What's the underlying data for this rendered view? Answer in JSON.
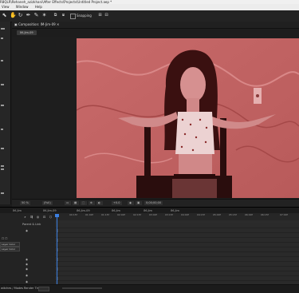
{
  "app": {
    "title_path": "R8QLR\\Rehaneh_azizkhani\\After Effects\\Projects\\Untitled Project.aep *"
  },
  "menu": {
    "items": [
      "View",
      "Window",
      "Help"
    ]
  },
  "toolbar": {
    "tools": [
      "selection-tool-icon",
      "hand-tool-icon",
      "rotate-tool-icon",
      "pen-tool-icon",
      "brush-tool-icon",
      "puppet-tool-icon"
    ],
    "snapping_label": "Snapping"
  },
  "composition": {
    "panel_tab": "Composition: IM-Jim-09",
    "sub_tab": "IM-Jim-09"
  },
  "viewer_bar": {
    "zoom": "50 %",
    "resolution": "(Full)",
    "timecode": "0;00;00;00",
    "exposure": "+0.0"
  },
  "timeline": {
    "tabs": [
      "IM-Jim",
      "IM-Jim-09",
      "IM-Jim-09",
      "IM-Jim",
      "IM-Jim",
      "IM-Jim"
    ],
    "parent_link_header": "Parent & Link",
    "dropdowns": [
      "Layer Color",
      "Layer Color"
    ],
    "ruler_ticks": [
      "0f",
      "00:15f",
      "01:00f",
      "01:15f",
      "02:00f",
      "02:15f",
      "03:00f",
      "03:15f",
      "04:00f",
      "04:15f",
      "05:00f",
      "05:15f",
      "06:00f",
      "06:15f",
      "07:00f"
    ],
    "mode_label": "Toggle Switches / Modes",
    "footer_left": "Render Time"
  },
  "status": {
    "left": "witches / Modes"
  }
}
